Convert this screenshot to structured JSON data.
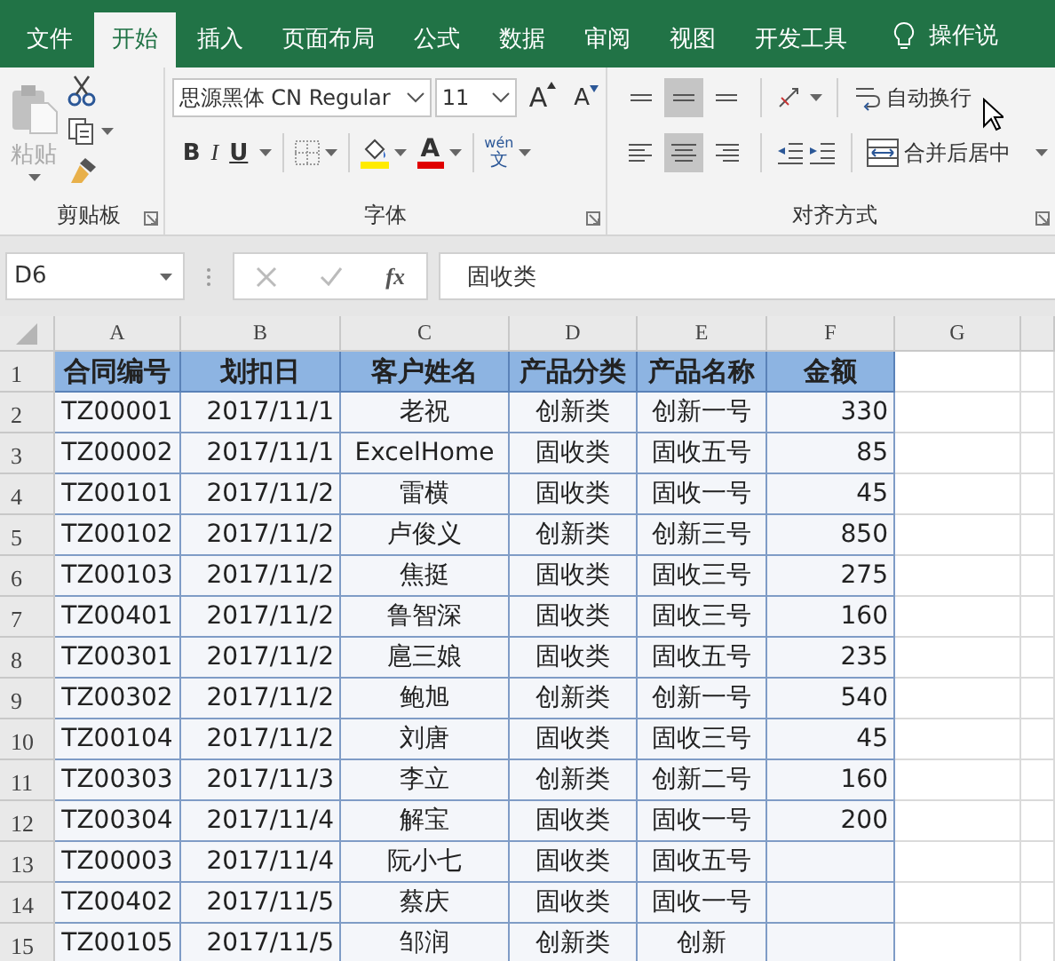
{
  "tabs": [
    {
      "label": "文件",
      "selected": false
    },
    {
      "label": "开始",
      "selected": true
    },
    {
      "label": "插入",
      "selected": false
    },
    {
      "label": "页面布局",
      "selected": false
    },
    {
      "label": "公式",
      "selected": false
    },
    {
      "label": "数据",
      "selected": false
    },
    {
      "label": "审阅",
      "selected": false
    },
    {
      "label": "视图",
      "selected": false
    },
    {
      "label": "开发工具",
      "selected": false
    }
  ],
  "tell_me": "操作说",
  "clipboard": {
    "title": "剪贴板",
    "paste": "粘贴"
  },
  "font": {
    "title": "字体",
    "font_name": "思源黑体 CN Regular",
    "font_size": "11",
    "grow": "A",
    "shrink": "A",
    "bold": "B",
    "italic": "I",
    "underline": "U",
    "font_color": "A",
    "phonetic_top": "wén",
    "phonetic_bottom": "文"
  },
  "alignment": {
    "title": "对齐方式",
    "wrap_text": "自动换行",
    "merge_center": "合并后居中",
    "rows": [
      [
        {
          "kind": "top",
          "selected": false
        },
        {
          "kind": "middle",
          "selected": true
        },
        {
          "kind": "bottom",
          "selected": false
        }
      ],
      [
        {
          "kind": "left",
          "selected": false
        },
        {
          "kind": "center",
          "selected": true
        },
        {
          "kind": "right",
          "selected": false
        }
      ]
    ]
  },
  "formula_bar": {
    "name_box": "D6",
    "fx": "fx",
    "value": "固收类"
  },
  "sheet": {
    "columns": [
      "A",
      "B",
      "C",
      "D",
      "E",
      "F",
      "G"
    ],
    "rows": [
      {
        "number": "1",
        "kind": "header",
        "cells": [
          "合同编号",
          "划扣日",
          "客户姓名",
          "产品分类",
          "产品名称",
          "金额"
        ]
      },
      {
        "number": "2",
        "kind": "data",
        "cells": [
          "TZ00001",
          "2017/11/1",
          "老祝",
          "创新类",
          "创新一号",
          "330"
        ]
      },
      {
        "number": "3",
        "kind": "data",
        "cells": [
          "TZ00002",
          "2017/11/1",
          "ExcelHome",
          "固收类",
          "固收五号",
          "85"
        ]
      },
      {
        "number": "4",
        "kind": "data",
        "cells": [
          "TZ00101",
          "2017/11/2",
          "雷横",
          "固收类",
          "固收一号",
          "45"
        ]
      },
      {
        "number": "5",
        "kind": "data",
        "cells": [
          "TZ00102",
          "2017/11/2",
          "卢俊义",
          "创新类",
          "创新三号",
          "850"
        ]
      },
      {
        "number": "6",
        "kind": "data",
        "cells": [
          "TZ00103",
          "2017/11/2",
          "焦挺",
          "固收类",
          "固收三号",
          "275"
        ]
      },
      {
        "number": "7",
        "kind": "data",
        "cells": [
          "TZ00401",
          "2017/11/2",
          "鲁智深",
          "固收类",
          "固收三号",
          "160"
        ]
      },
      {
        "number": "8",
        "kind": "data",
        "cells": [
          "TZ00301",
          "2017/11/2",
          "扈三娘",
          "固收类",
          "固收五号",
          "235"
        ]
      },
      {
        "number": "9",
        "kind": "data",
        "cells": [
          "TZ00302",
          "2017/11/2",
          "鲍旭",
          "创新类",
          "创新一号",
          "540"
        ]
      },
      {
        "number": "10",
        "kind": "data",
        "cells": [
          "TZ00104",
          "2017/11/2",
          "刘唐",
          "固收类",
          "固收三号",
          "45"
        ]
      },
      {
        "number": "11",
        "kind": "data",
        "cells": [
          "TZ00303",
          "2017/11/3",
          "李立",
          "创新类",
          "创新二号",
          "160"
        ]
      },
      {
        "number": "12",
        "kind": "data",
        "cells": [
          "TZ00304",
          "2017/11/4",
          "解宝",
          "固收类",
          "固收一号",
          "200"
        ]
      },
      {
        "number": "13",
        "kind": "data",
        "cells": [
          "TZ00003",
          "2017/11/4",
          "阮小七",
          "固收类",
          "固收五号"
        ]
      },
      {
        "number": "14",
        "kind": "data",
        "cells": [
          "TZ00402",
          "2017/11/5",
          "蔡庆",
          "固收类",
          "固收一号"
        ]
      },
      {
        "number": "15",
        "kind": "data",
        "cells": [
          "TZ00105",
          "2017/11/5",
          "邹润",
          "创新类",
          "创新"
        ]
      }
    ]
  }
}
